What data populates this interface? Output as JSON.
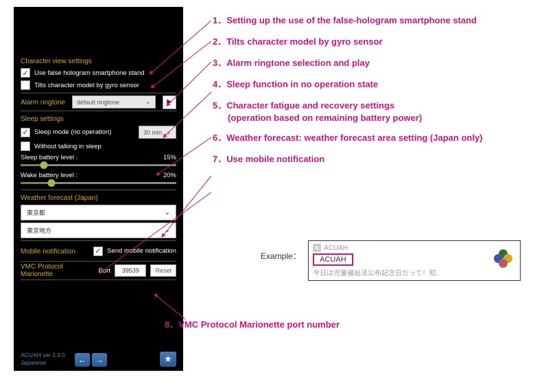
{
  "sections": {
    "charview_title": "Character view settings",
    "false_holo": "Use false hologram smartphone stand",
    "gyro": "Tilts character model by gyro sensor",
    "alarm_title": "Alarm ringtone",
    "alarm_default": "default ringtone",
    "sleep_title": "Sleep settings",
    "sleep_mode": "Sleep mode (no operation)",
    "sleep_time": "30 min.",
    "without_talking": "Without talking in sleep",
    "sleep_battery_label": "Sleep battery level :",
    "sleep_battery_val": "15%",
    "wake_battery_label": "Wake battery level :",
    "wake_battery_val": "20%",
    "weather_title": "Weather forecast (Japan)",
    "weather_pref": "東京都",
    "weather_area": "東京地方",
    "mobile_title": "Mobile notification",
    "mobile_send": "Send mobile notification",
    "vmc_title": "VMC Protocol Marionette",
    "vmc_port_label": "Port",
    "vmc_port": "39539",
    "vmc_reset": "Reset"
  },
  "footer": {
    "version": "ACUAH ver.3.3.0",
    "lang": "Japanese"
  },
  "annotations": {
    "a1": "1．Setting up the use of the false-hologram smartphone stand",
    "a2": "2．Tilts character model by gyro sensor",
    "a3": "3．Alarm ringtone selection and play",
    "a4": "4．Sleep function in no operation state",
    "a5": "5．Character fatigue and recovery settings",
    "a5b": "(operation based on remaining battery power)",
    "a6": "6．Weather forecast: weather forecast area setting (Japan only)",
    "a7": "7．Use mobile notification",
    "a8": "8．VMC Protocol Marionette port number"
  },
  "example": {
    "label": "Example：",
    "app": "ACUAH",
    "title": "ACUAH",
    "body": "今日は児童福祉法公布記念日だって！知.."
  }
}
